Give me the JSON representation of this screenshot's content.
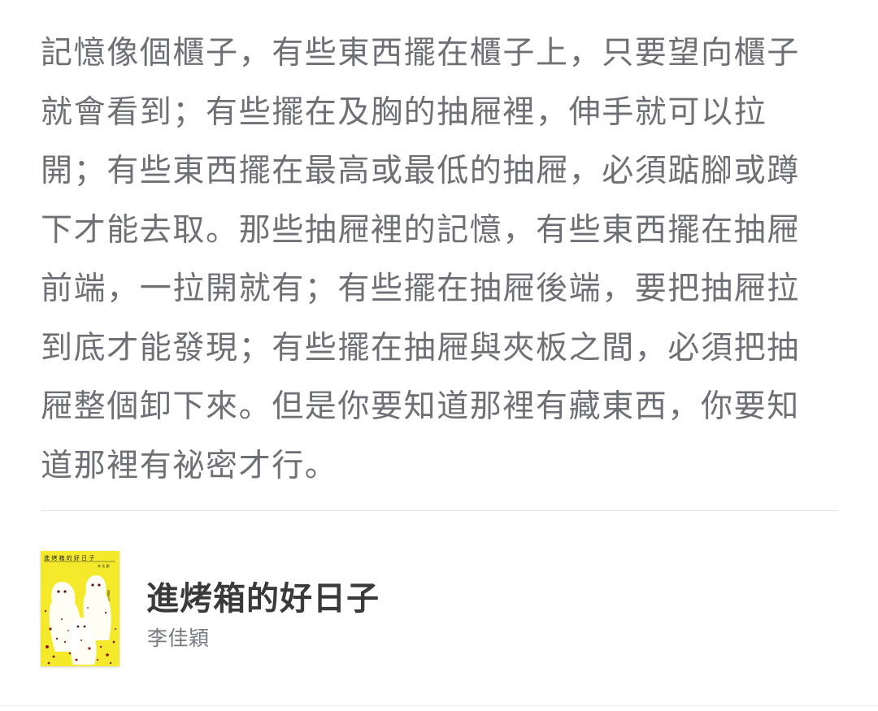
{
  "quote": {
    "text": "記憶像個櫃子，有些東西擺在櫃子上，只要望向櫃子\n就會看到；有些擺在及胸的抽屜裡，伸手就可以拉\n開；有些東西擺在最高或最低的抽屜，必須踮腳或蹲\n下才能去取。那些抽屜裡的記憶，有些東西擺在抽屜\n前端，一拉開就有；有些擺在抽屜後端，要把抽屜拉\n到底才能發現；有些擺在抽屜與夾板之間，必須把抽\n屜整個卸下來。但是你要知道那裡有藏東西，你要知\n道那裡有祕密才行。"
  },
  "book": {
    "title": "進烤箱的好日子",
    "author": "李佳穎",
    "cover": {
      "title_text": "進烤箱的好日子",
      "author_text": "李佳穎",
      "background_color": "#f4ea2b",
      "figure_color": "#ffffff",
      "splatter_color": "#8b1a1a"
    }
  }
}
